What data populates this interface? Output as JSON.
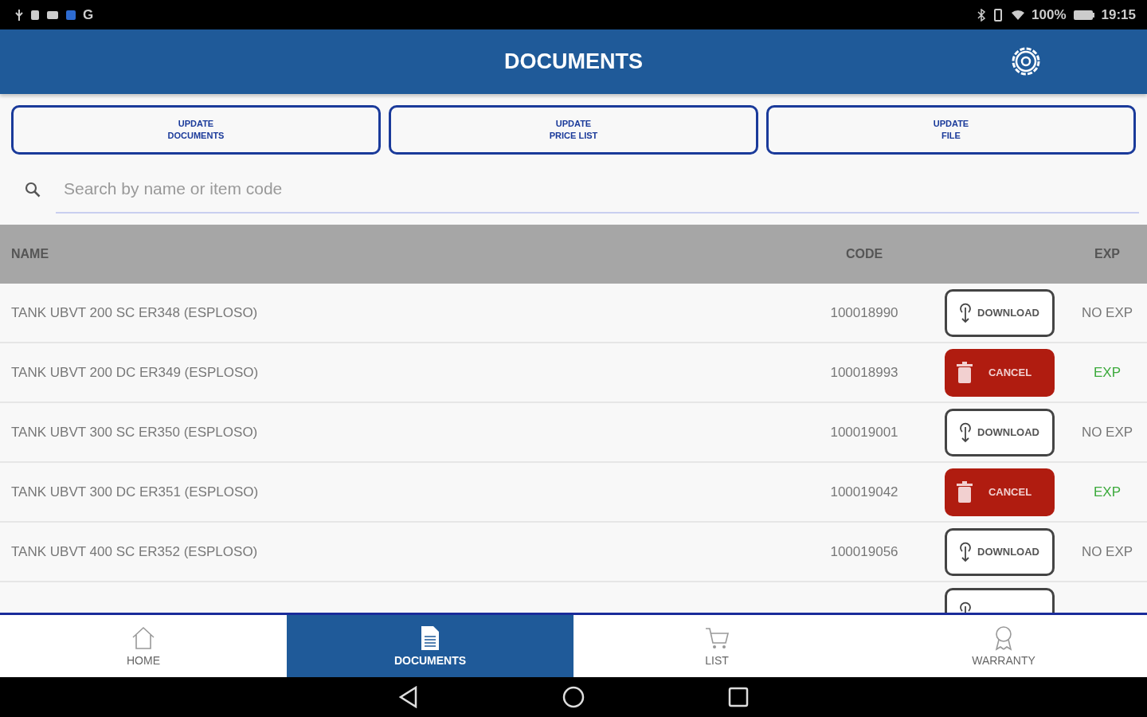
{
  "status_bar": {
    "carrier": "G",
    "battery": "100%",
    "time": "19:15"
  },
  "header": {
    "title": "DOCUMENTS"
  },
  "actions": [
    {
      "line1": "UPDATE",
      "line2": "DOCUMENTS"
    },
    {
      "line1": "UPDATE",
      "line2": "PRICE LIST"
    },
    {
      "line1": "UPDATE",
      "line2": "FILE"
    }
  ],
  "search": {
    "placeholder": "Search by name or item code"
  },
  "table": {
    "columns": [
      "NAME",
      "CODE",
      "EXP"
    ],
    "rows": [
      {
        "name": "TANK UBVT 200 SC ER348  (ESPLOSO)",
        "code": "100018990",
        "kind": "download",
        "action": "DOWNLOAD",
        "exp": "NO EXP"
      },
      {
        "name": "TANK UBVT 200 DC ER349  (ESPLOSO)",
        "code": "100018993",
        "kind": "cancel",
        "action": "CANCEL",
        "exp": "EXP"
      },
      {
        "name": "TANK UBVT 300 SC ER350  (ESPLOSO)",
        "code": "100019001",
        "kind": "download",
        "action": "DOWNLOAD",
        "exp": "NO EXP"
      },
      {
        "name": "TANK UBVT 300 DC ER351  (ESPLOSO)",
        "code": "100019042",
        "kind": "cancel",
        "action": "CANCEL",
        "exp": "EXP"
      },
      {
        "name": "TANK UBVT 400 SC ER352  (ESPLOSO)",
        "code": "100019056",
        "kind": "download",
        "action": "DOWNLOAD",
        "exp": "NO EXP"
      },
      {
        "kind": "download"
      }
    ]
  },
  "tabs": [
    {
      "label": "HOME",
      "selected": false
    },
    {
      "label": "DOCUMENTS",
      "selected": true
    },
    {
      "label": "LIST",
      "selected": false
    },
    {
      "label": "WARRANTY",
      "selected": false
    }
  ]
}
